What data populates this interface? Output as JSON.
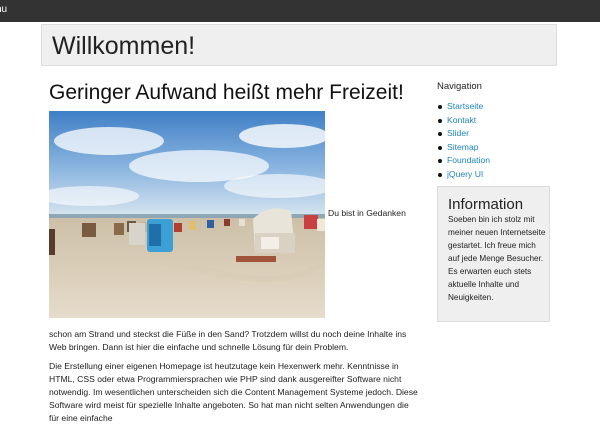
{
  "topbar": {
    "menu_label": "nu"
  },
  "header": {
    "title": "Willkommen!"
  },
  "main": {
    "heading": "Geringer Aufwand heißt mehr Freizeit!",
    "inline_text": "Du bist in Gedanken",
    "paragraph_1": "schon am Strand und steckst die Füße in den Sand? Trotzdem willst du noch deine Inhalte ins Web bringen. Dann ist hier die einfache und schnelle Lösung für dein Problem.",
    "paragraph_2": "Die Erstellung einer eigenen Homepage ist heutzutage kein Hexenwerk mehr. Kenntnisse in HTML, CSS oder etwa Programmiersprachen wie PHP sind dank ausgereifter Software nicht notwendig. Im wesentlichen unterscheiden sich die Content Management Systeme jedoch. Diese Software wird meist für spezielle Inhalte angeboten. So hat man nicht selten Anwendungen die für eine einfache"
  },
  "sidebar": {
    "nav_title": "Navigation",
    "nav_items": [
      {
        "label": "Startseite"
      },
      {
        "label": "Kontakt"
      },
      {
        "label": "Slider"
      },
      {
        "label": "Sitemap"
      },
      {
        "label": "Foundation"
      },
      {
        "label": "jQuery UI"
      }
    ],
    "info_title": "Information",
    "info_text": "Soeben bin ich stolz mit meiner neuen Internetseite gestartet. Ich freue mich auf jede Menge Besucher. Es erwarten euch stets aktuelle Inhalte und Neuigkeiten."
  },
  "colors": {
    "topbar": "#333333",
    "link": "#1e86b8",
    "panel": "#efefef",
    "border": "#dddddd"
  }
}
